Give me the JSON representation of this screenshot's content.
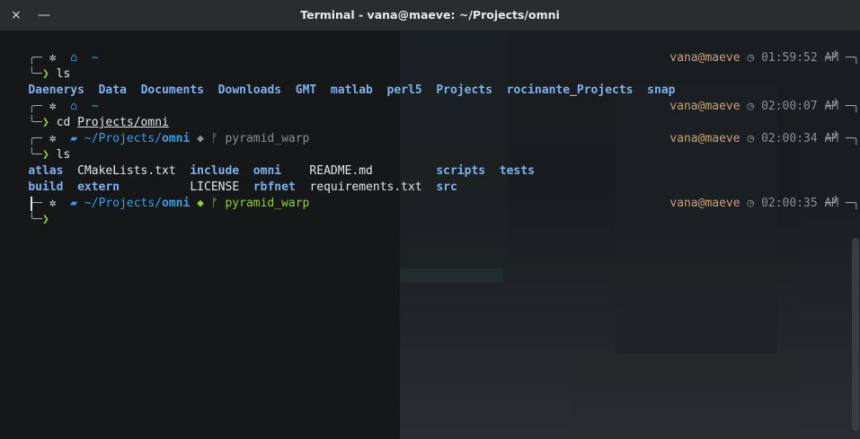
{
  "window": {
    "title": "Terminal - vana@maeve: ~/Projects/omni",
    "close_icon": "×",
    "minimize_icon": "—"
  },
  "prompts": [
    {
      "path": "~",
      "path_bold": "",
      "git_icon": "",
      "branch_icon": "",
      "branch": "",
      "user_host": "vana@maeve",
      "time": "01:59:52 AM",
      "command": "ls"
    },
    {
      "path": "~",
      "path_bold": "",
      "git_icon": "",
      "branch_icon": "",
      "branch": "",
      "user_host": "vana@maeve",
      "time": "02:00:07 AM",
      "command_prefix": "cd ",
      "command_arg": "Projects/omni"
    },
    {
      "path": "~/Projects/",
      "path_bold": "omni",
      "git_icon": "gitlab-icon",
      "branch_icon": "ᚠ",
      "branch": "pyramid_warp",
      "user_host": "vana@maeve",
      "time": "02:00:34 AM",
      "command": "ls"
    },
    {
      "path": "~/Projects/",
      "path_bold": "omni",
      "git_icon": "gitlab-icon",
      "branch_icon": "ᚠ",
      "branch": "pyramid_warp",
      "user_host": "vana@maeve",
      "time": "02:00:35 AM",
      "command": ""
    }
  ],
  "ls_home": [
    "Daenerys",
    "Data",
    "Documents",
    "Downloads",
    "GMT",
    "matlab",
    "perl5",
    "Projects",
    "rocinante_Projects",
    "snap"
  ],
  "ls_omni": {
    "row1": [
      "atlas",
      "CMakeLists.txt",
      "include",
      "omni",
      "README.md",
      "scripts",
      "tests"
    ],
    "row2": [
      "build",
      "extern",
      "LICENSE",
      "rbfnet",
      "requirements.txt",
      "src"
    ]
  },
  "glyphs": {
    "frame_top": "╭─",
    "frame_bottom": "╰─",
    "prompt_arrow": "❯",
    "gear": "✲",
    "home": "⌂",
    "folder": "▰",
    "clock": "◷",
    "frame_end_top": "─╮",
    "frame_end_bottom": "─╯"
  },
  "colors": {
    "accent_blue": "#3aa0e6",
    "prompt_green": "#8fd12f",
    "user_host": "#c7a27d",
    "dir_blue": "#7fb2f0"
  }
}
